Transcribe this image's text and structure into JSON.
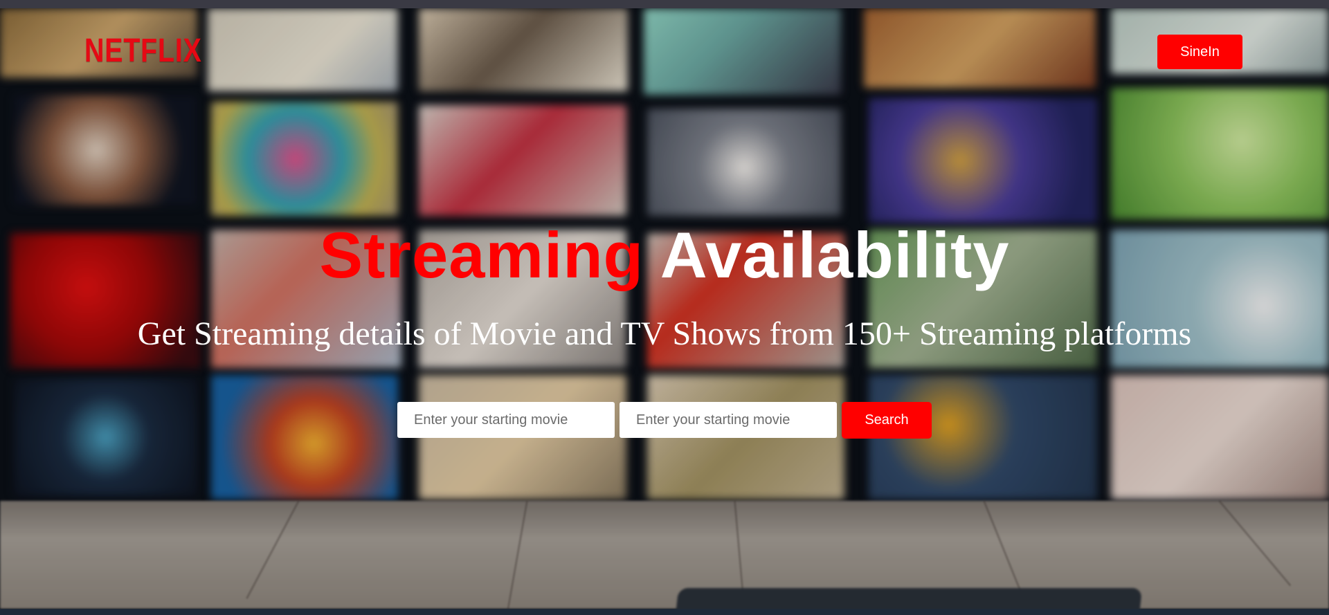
{
  "header": {
    "logo_text": "NETFLIX",
    "signin_label": "SineIn"
  },
  "hero": {
    "headline_red": "Streaming",
    "headline_white": "Availability",
    "subtitle": "Get Streaming details of Movie and TV Shows from 150+ Streaming platforms"
  },
  "search": {
    "input1_placeholder": "Enter your starting movie",
    "input2_placeholder": "Enter your starting movie",
    "button_label": "Search"
  },
  "colors": {
    "brand_red": "#ff0000",
    "logo_red": "#e50914",
    "text_white": "#ffffff"
  }
}
